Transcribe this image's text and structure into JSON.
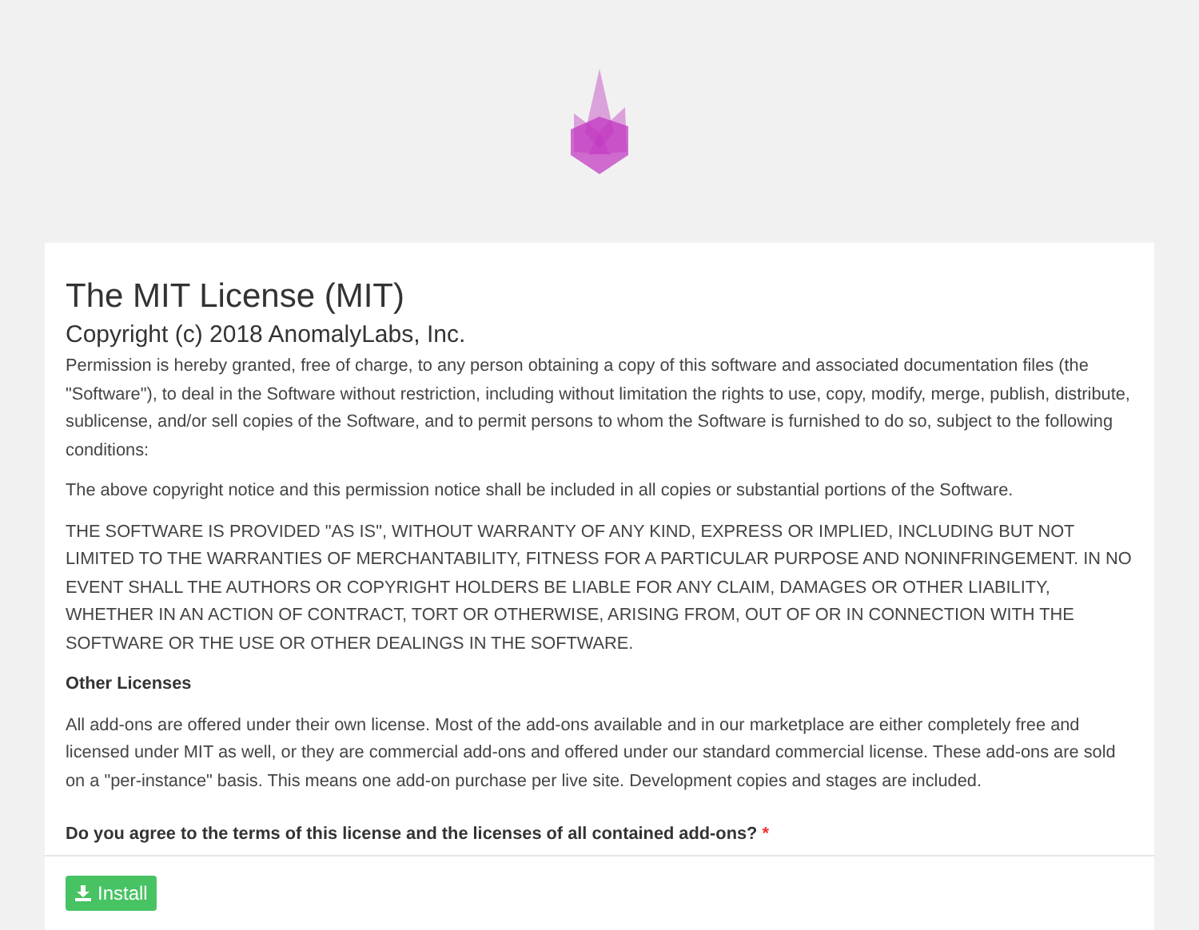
{
  "title": "The MIT License (MIT)",
  "copyright": "Copyright (c) 2018 AnomalyLabs, Inc.",
  "paragraphs": [
    "Permission is hereby granted, free of charge, to any person obtaining a copy of this software and associated documentation files (the \"Software\"), to deal in the Software without restriction, including without limitation the rights to use, copy, modify, merge, publish, distribute, sublicense, and/or sell copies of the Software, and to permit persons to whom the Software is furnished to do so, subject to the following conditions:",
    "The above copyright notice and this permission notice shall be included in all copies or substantial portions of the Software.",
    "THE SOFTWARE IS PROVIDED \"AS IS\", WITHOUT WARRANTY OF ANY KIND, EXPRESS OR IMPLIED, INCLUDING BUT NOT LIMITED TO THE WARRANTIES OF MERCHANTABILITY, FITNESS FOR A PARTICULAR PURPOSE AND NONINFRINGEMENT. IN NO EVENT SHALL THE AUTHORS OR COPYRIGHT HOLDERS BE LIABLE FOR ANY CLAIM, DAMAGES OR OTHER LIABILITY, WHETHER IN AN ACTION OF CONTRACT, TORT OR OTHERWISE, ARISING FROM, OUT OF OR IN CONNECTION WITH THE SOFTWARE OR THE USE OR OTHER DEALINGS IN THE SOFTWARE."
  ],
  "other_heading": "Other Licenses",
  "other_text": "All add-ons are offered under their own license. Most of the add-ons available and in our marketplace are either completely free and licensed under MIT as well, or they are commercial add-ons and offered under our standard commercial license. These add-ons are sold on a \"per-instance\" basis. This means one add-on purchase per live site. Development copies and stages are included.",
  "question": {
    "label": "Do you agree to the terms of this license and the licenses of all contained add-ons?",
    "required_mark": "*"
  },
  "install_button": "Install"
}
